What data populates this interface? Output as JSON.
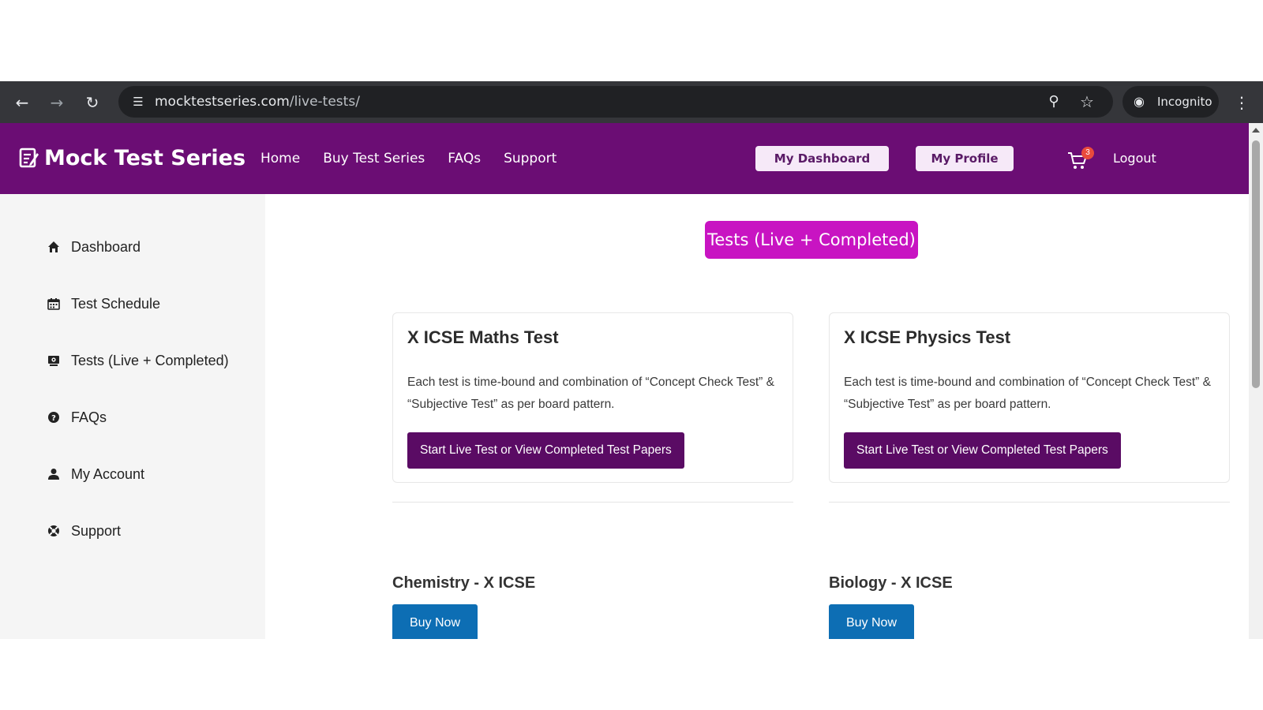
{
  "browser": {
    "url_host": "mocktestseries.com",
    "url_path": "/live-tests/",
    "incognito_label": "Incognito",
    "icons": [
      "back-icon",
      "forward-icon",
      "reload-icon",
      "site-settings-icon",
      "zoom-icon",
      "bookmark-star-icon",
      "incognito-icon",
      "menu-kebab-icon"
    ]
  },
  "header": {
    "logo_text": "Mock Test Series",
    "nav": [
      "Home",
      "Buy Test Series",
      "FAQs",
      "Support"
    ],
    "dashboard_button": "My Dashboard",
    "profile_button": "My Profile",
    "cart_count": "3",
    "logout": "Logout",
    "colors": {
      "header_bg": "#6b0d74",
      "button_bg": "#f6e9f8"
    }
  },
  "sidebar": {
    "items": [
      {
        "label": "Dashboard",
        "icon": "home-icon"
      },
      {
        "label": "Test Schedule",
        "icon": "calendar-icon"
      },
      {
        "label": "Tests (Live + Completed)",
        "icon": "tests-icon"
      },
      {
        "label": "FAQs",
        "icon": "question-icon"
      },
      {
        "label": "My Account",
        "icon": "user-icon"
      },
      {
        "label": "Support",
        "icon": "lifebuoy-icon"
      }
    ]
  },
  "main": {
    "page_title": "Tests (Live + Completed)",
    "cards": [
      {
        "title": "X ICSE Maths Test",
        "description": "Each test is time-bound and combination of “Concept Check Test” & “Subjective Test” as per board pattern.",
        "button": "Start Live Test or View Completed Test Papers"
      },
      {
        "title": "X ICSE Physics Test",
        "description": "Each test is time-bound and combination of “Concept Check Test” & “Subjective Test” as per board pattern.",
        "button": "Start Live Test or View Completed Test Papers"
      }
    ],
    "products": [
      {
        "title": "Chemistry - X ICSE",
        "button": "Buy Now"
      },
      {
        "title": "Biology - X ICSE",
        "button": "Buy Now"
      }
    ],
    "colors": {
      "title_pill": "#c814c2",
      "card_button": "#5a0b64",
      "buy_button": "#0d6eb4"
    }
  }
}
